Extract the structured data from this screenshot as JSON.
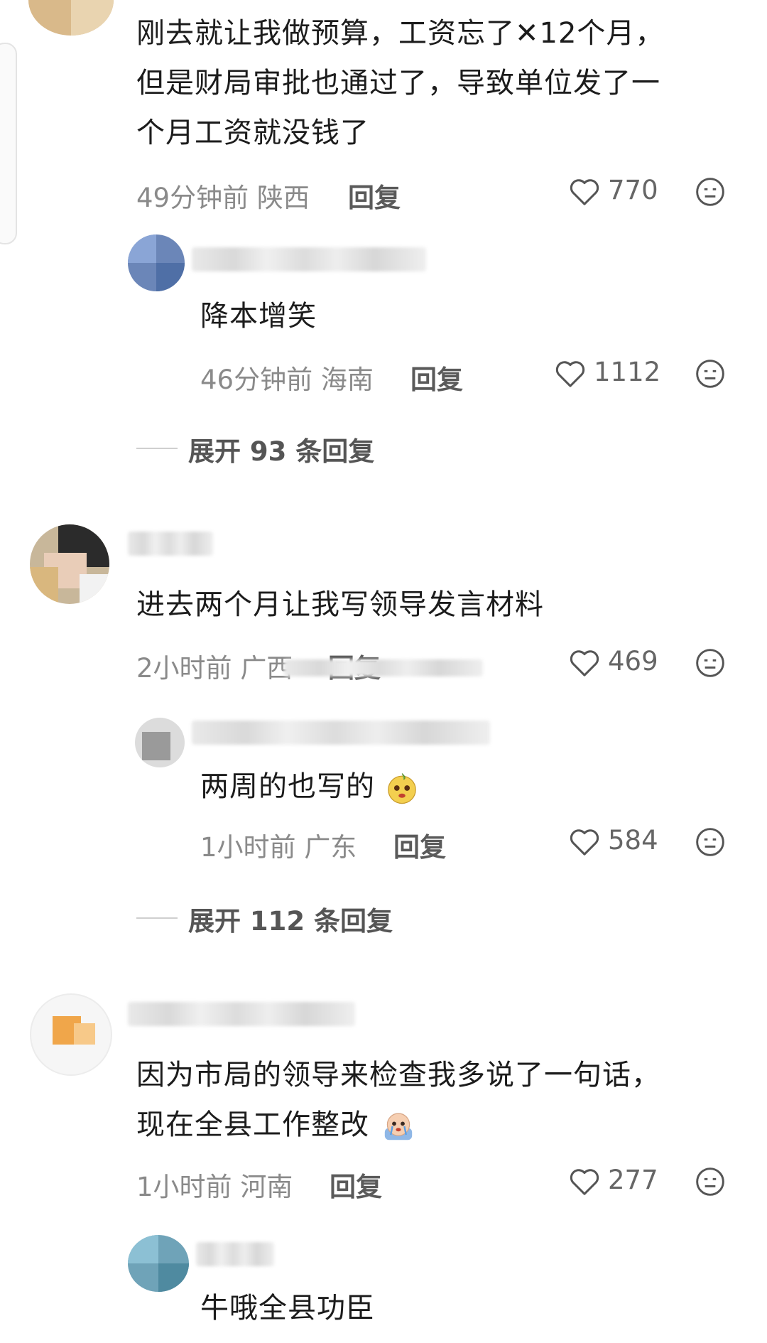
{
  "comments": [
    {
      "text_lines": [
        "刚去就让我做预算，工资忘了✕12个月，",
        "但是财局审批也通过了，导致单位发了一",
        "个月工资就没钱了"
      ],
      "time": "49分钟前",
      "location": "陕西",
      "reply_label": "回复",
      "likes": "770",
      "replies": [
        {
          "text": "降本增笑",
          "time": "46分钟前",
          "location": "海南",
          "reply_label": "回复",
          "likes": "1112"
        }
      ],
      "expand_label": "展开 93 条回复"
    },
    {
      "text_lines": [
        "进去两个月让我写领导发言材料"
      ],
      "time": "2小时前",
      "location": "广西",
      "reply_label": "回复",
      "likes": "469",
      "replies": [
        {
          "text": "两周的也写的",
          "time": "1小时前",
          "location": "广东",
          "reply_label": "回复",
          "likes": "584"
        }
      ],
      "expand_label": "展开 112 条回复"
    },
    {
      "text_lines": [
        "因为市局的领导来检查我多说了一句话，",
        "现在全县工作整改"
      ],
      "time": "1小时前",
      "location": "河南",
      "reply_label": "回复",
      "likes": "277",
      "replies": [
        {
          "text": "牛哦全县功臣"
        }
      ]
    }
  ],
  "icons": {
    "like": "heart-outline-icon",
    "react": "meh-face-icon"
  },
  "colors": {
    "text": "#1c1c1c",
    "meta": "#8a8a8a",
    "reply": "#5a5a5a"
  }
}
